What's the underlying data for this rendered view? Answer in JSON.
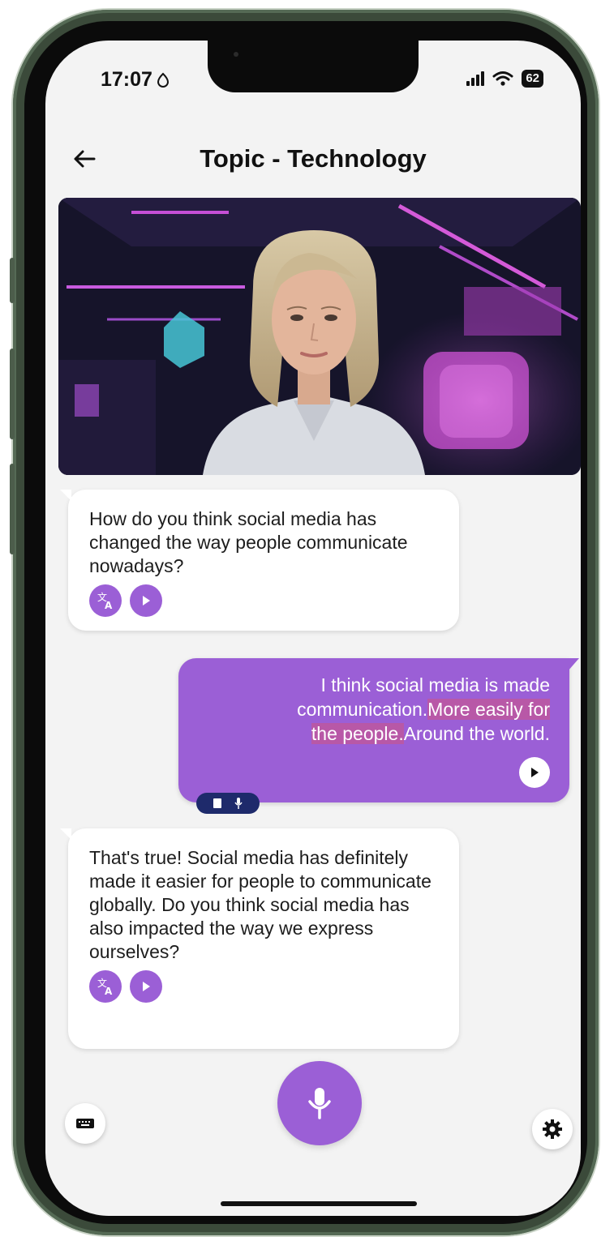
{
  "status_bar": {
    "time": "17:07",
    "battery": "62"
  },
  "header": {
    "title": "Topic - Technology"
  },
  "messages": [
    {
      "role": "assistant",
      "text": "How do you think social media has changed the way people communicate nowadays?"
    },
    {
      "role": "user",
      "text_plain": "I think social media is made communication.",
      "text_highlight_1": "More easily for",
      "text_highlight_2": "the people.",
      "text_end": "Around the world."
    },
    {
      "role": "assistant",
      "text": "That's true! Social media has definitely made it easier for people to communicate globally. Do you think social media has also impacted the way we express ourselves?"
    }
  ],
  "colors": {
    "accent": "#9b5fd6",
    "badge": "#1e2a6b",
    "background": "#f3f3f3",
    "frame": "#3b4a3a"
  },
  "icons": {
    "back": "arrow-left-icon",
    "translate": "translate-icon",
    "play": "play-icon",
    "mic": "microphone-icon",
    "keyboard": "keyboard-icon",
    "settings": "gear-icon"
  }
}
